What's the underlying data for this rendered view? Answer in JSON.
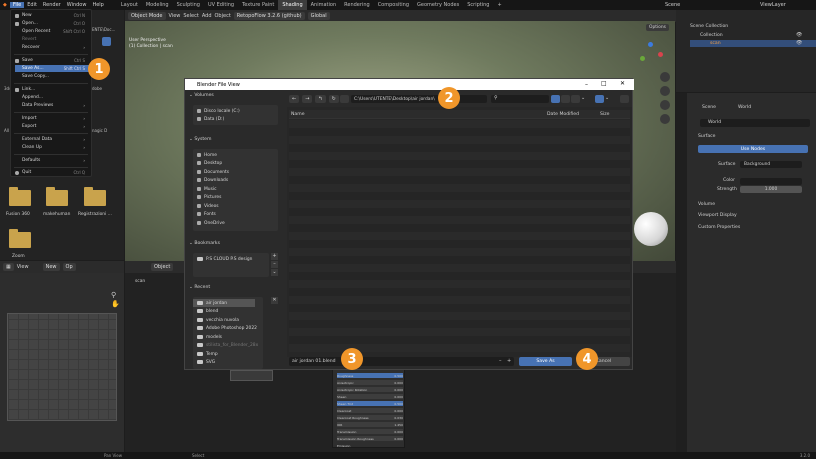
{
  "topmenu": [
    "File",
    "Edit",
    "Render",
    "Window",
    "Help"
  ],
  "workspaces": [
    "Layout",
    "Modeling",
    "Sculpting",
    "UV Editing",
    "Texture Paint",
    "Shading",
    "Animation",
    "Rendering",
    "Compositing",
    "Geometry Nodes",
    "Scripting"
  ],
  "active_workspace": "Shading",
  "scene_label": "Scene",
  "viewlayer_label": "ViewLayer",
  "file_menu": {
    "items": [
      {
        "label": "New",
        "key": "Ctrl N"
      },
      {
        "label": "Open...",
        "key": "Ctrl O"
      },
      {
        "label": "Open Recent",
        "key": "Shift Ctrl O"
      },
      {
        "label": "Revert",
        "key": ""
      },
      {
        "label": "Recover",
        "key": ""
      },
      {
        "label": "Save",
        "key": "Ctrl S"
      },
      {
        "label": "Save As...",
        "key": "Shift Ctrl S"
      },
      {
        "label": "Save Copy...",
        "key": ""
      },
      {
        "label": "Link...",
        "key": ""
      },
      {
        "label": "Append...",
        "key": ""
      },
      {
        "label": "Data Previews",
        "key": ""
      },
      {
        "label": "Import",
        "key": ""
      },
      {
        "label": "Export",
        "key": ""
      },
      {
        "label": "External Data",
        "key": ""
      },
      {
        "label": "Clean Up",
        "key": ""
      },
      {
        "label": "Defaults",
        "key": ""
      },
      {
        "label": "Quit",
        "key": "Ctrl Q"
      }
    ]
  },
  "left_browser": {
    "path_fragment": "ENTE\\Doc...",
    "folders": [
      "Fusion 360",
      "makehuman",
      "Registrazioni ..."
    ],
    "folder_partial": "Zoom",
    "side_labels": [
      "3ds",
      "All",
      "dobe",
      "nagic D"
    ]
  },
  "viewport": {
    "mode": "Object Mode",
    "menu": [
      "View",
      "Select",
      "Add",
      "Object"
    ],
    "addon": "RetopoFlow 3.2.6 (github)",
    "transform": "Global",
    "overlay_line1": "User Perspective",
    "overlay_line2": "(1) Collection | scan",
    "options": "Options"
  },
  "node_header": {
    "view": "View",
    "new": "New",
    "op": "Op",
    "object": "Object",
    "breadcrumb": "scan"
  },
  "image_editor": {
    "view": "View"
  },
  "outliner": {
    "title": "Scene Collection",
    "collection": "Collection",
    "object": "scan"
  },
  "properties": {
    "scene": "Scene",
    "world_crumb": "World",
    "world_name": "World",
    "surface_section": "Surface",
    "use_nodes": "Use Nodes",
    "surface_label": "Surface",
    "surface_value": "Background",
    "color_label": "Color",
    "strength_label": "Strength",
    "strength_value": "1.000",
    "volume": "Volume",
    "viewport_display": "Viewport Display",
    "custom_properties": "Custom Properties"
  },
  "dialog": {
    "title": "Blender File View",
    "path": "C:\\Users\\UTENTE\\Desktop\\air jordan\\",
    "col_name": "Name",
    "col_date": "Date Modified",
    "col_size": "Size",
    "volumes_header": "Volumes",
    "volumes": [
      "Disco locale (C:)",
      "Data (D:)"
    ],
    "system_header": "System",
    "system": [
      "Home",
      "Desktop",
      "Documents",
      "Downloads",
      "Music",
      "Pictures",
      "Videos",
      "Fonts",
      "OneDrive"
    ],
    "bookmarks_header": "Bookmarks",
    "bookmarks": [
      "P.S CLOUD P.S design"
    ],
    "recent_header": "Recent",
    "recent": [
      "air jordan",
      "blend",
      "vecchia nuvola",
      "Adobe Photoshop 2022",
      "models",
      "stilista_for_Blender_28x",
      "Temp",
      "SVG"
    ],
    "filename": "air jordan 01.blend",
    "save_label": "Save As",
    "cancel_label": "Cancel"
  },
  "nodes": {
    "rows": [
      "Roughness",
      "Anisotropic",
      "Anisotropic Rotation",
      "Sheen",
      "Sheen Tint",
      "Clearcoat",
      "Clearcoat Roughness",
      "IOR",
      "Transmission",
      "Transmission Roughness",
      "Emission"
    ],
    "values": [
      "0.500",
      "0.000",
      "0.000",
      "0.000",
      "0.500",
      "0.000",
      "0.030",
      "1.450",
      "0.000",
      "0.000",
      ""
    ]
  },
  "statusbar": {
    "left": "Pan View",
    "mid": "Select",
    "version": "3.2.0"
  },
  "badges": [
    "1",
    "2",
    "3",
    "4"
  ],
  "colors": {
    "accent": "#4772b3",
    "badge": "#f0962a",
    "folder": "#c9a34c"
  }
}
